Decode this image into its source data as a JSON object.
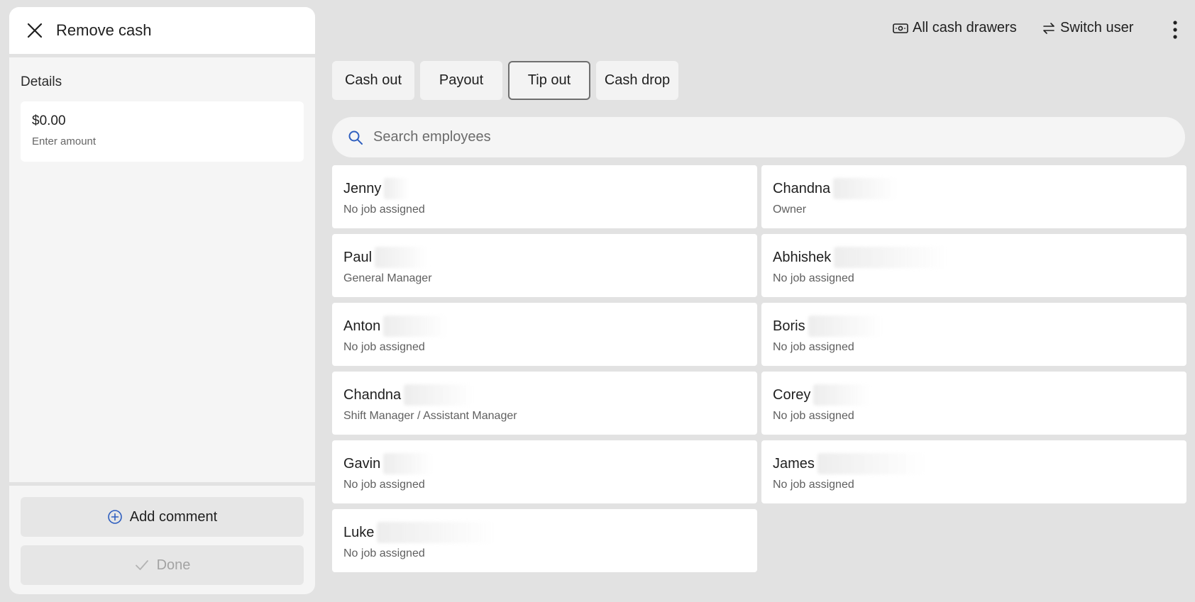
{
  "panel": {
    "title": "Remove cash",
    "details_label": "Details",
    "amount_value": "$0.00",
    "amount_hint": "Enter amount",
    "add_comment_label": "Add comment",
    "done_label": "Done"
  },
  "topbar": {
    "all_cash_drawers_label": "All cash drawers",
    "switch_user_label": "Switch user"
  },
  "tabs": [
    {
      "label": "Cash out",
      "active": false
    },
    {
      "label": "Payout",
      "active": false
    },
    {
      "label": "Tip out",
      "active": true
    },
    {
      "label": "Cash drop",
      "active": false
    }
  ],
  "search": {
    "placeholder": "Search employees"
  },
  "employees": [
    {
      "name": "Jenny",
      "job": "No job assigned"
    },
    {
      "name": "Chandna",
      "job": "Owner"
    },
    {
      "name": "Paul",
      "job": "General Manager"
    },
    {
      "name": "Abhishek",
      "job": "No job assigned"
    },
    {
      "name": "Anton",
      "job": "No job assigned"
    },
    {
      "name": "Boris",
      "job": "No job assigned"
    },
    {
      "name": "Chandna",
      "job": "Shift Manager / Assistant Manager"
    },
    {
      "name": "Corey",
      "job": "No job assigned"
    },
    {
      "name": "Gavin",
      "job": "No job assigned"
    },
    {
      "name": "James",
      "job": "No job assigned"
    },
    {
      "name": "Luke",
      "job": "No job assigned"
    }
  ],
  "colors": {
    "background": "#e2e2e2",
    "accent_blue": "#2f5fbf",
    "active_tab_border": "#6f6f6f"
  },
  "icons": {
    "close": "close-icon",
    "cash_drawer": "cash-drawer-icon",
    "switch_user": "swap-arrows-icon",
    "more": "more-vertical-icon",
    "search": "search-icon",
    "add_comment": "plus-circle-icon",
    "done": "check-icon"
  }
}
